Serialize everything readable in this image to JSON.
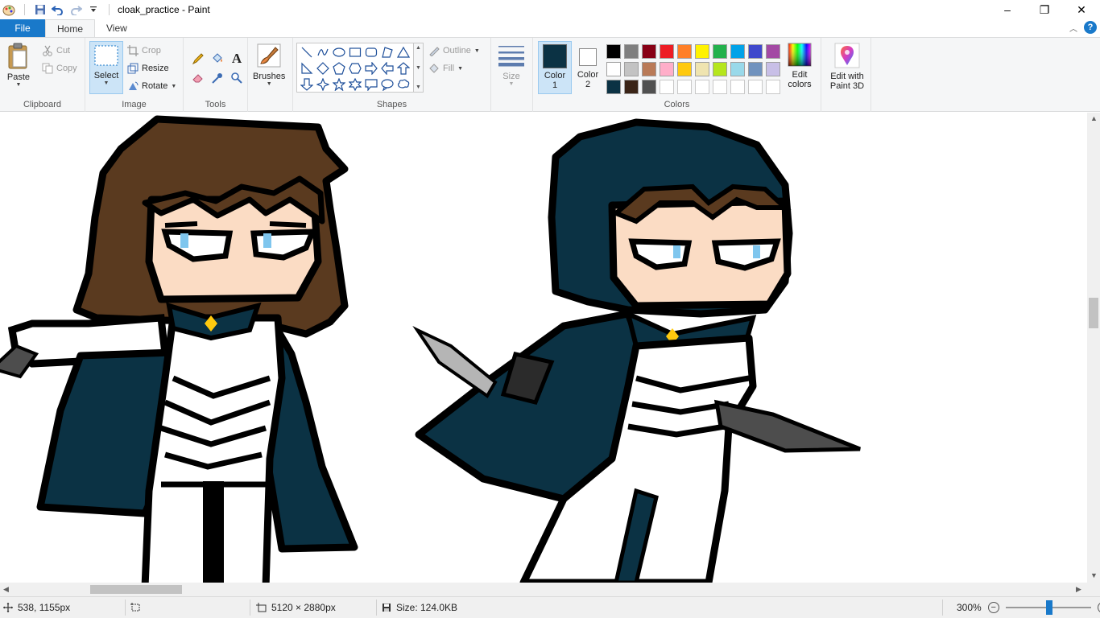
{
  "window": {
    "title": "cloak_practice - Paint",
    "minimize": "–",
    "maximize": "❐",
    "close": "✕"
  },
  "tabs": [
    {
      "label": "File"
    },
    {
      "label": "Home"
    },
    {
      "label": "View"
    }
  ],
  "help": "?",
  "ribbon": {
    "clipboard": {
      "label": "Clipboard",
      "paste": "Paste",
      "cut": "Cut",
      "copy": "Copy"
    },
    "image": {
      "label": "Image",
      "select": "Select",
      "crop": "Crop",
      "resize": "Resize",
      "rotate": "Rotate"
    },
    "tools": {
      "label": "Tools"
    },
    "brushes": {
      "label": "Brushes"
    },
    "shapes": {
      "label": "Shapes",
      "outline": "Outline",
      "fill": "Fill"
    },
    "size": {
      "label": "Size"
    },
    "colors": {
      "label": "Colors",
      "color1": "Color\n1",
      "color1_line1": "Color",
      "color1_line2": "1",
      "color2_line1": "Color",
      "color2_line2": "2",
      "edit_colors_line1": "Edit",
      "edit_colors_line2": "colors",
      "color1_value": "#0b3244",
      "color2_value": "#ffffff",
      "palette": [
        "#000000",
        "#7f7f7f",
        "#880015",
        "#ed1c24",
        "#ff7f27",
        "#fff200",
        "#22b14c",
        "#00a2e8",
        "#3f48cc",
        "#a349a4",
        "#ffffff",
        "#c3c3c3",
        "#b97a57",
        "#ffaec9",
        "#ffc90e",
        "#efe4b0",
        "#b5e61d",
        "#99d9ea",
        "#7092be",
        "#c8bfe7",
        "#0b3244",
        "#3a2417",
        "#505050",
        "#ffffff",
        "#ffffff",
        "#ffffff",
        "#ffffff",
        "#ffffff",
        "#ffffff",
        "#ffffff"
      ]
    },
    "paint3d": {
      "line1": "Edit with",
      "line2": "Paint 3D"
    }
  },
  "status": {
    "cursor_position": "538, 1155px",
    "image_dimensions": "5120 × 2880px",
    "file_size": "Size: 124.0KB",
    "zoom": "300%"
  }
}
